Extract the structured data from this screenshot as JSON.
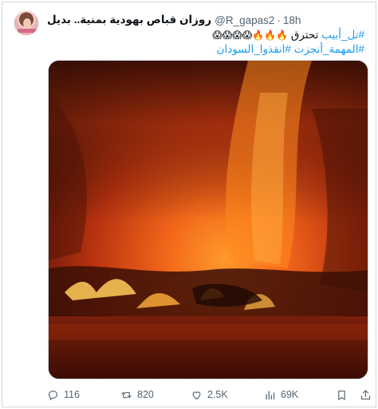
{
  "tweet": {
    "display_name": "روزان قباص بهودية بمنية.. بديل",
    "handle": "@R_gapas2",
    "separator": "·",
    "time": "18h",
    "line1_hashtag": "#تل_أبيب",
    "line1_text": "تحترق",
    "line1_emoji": "🔥🔥🔥😱😱😱😱",
    "line2_hashtags": "#المهمة_أنجزت #انقذوا_السودان"
  },
  "actions": {
    "replies": "116",
    "retweets": "820",
    "likes": "2.5K",
    "views": "69K"
  },
  "colors": {
    "link": "#1d9bf0",
    "muted": "#536471",
    "border": "#cfd9de"
  }
}
